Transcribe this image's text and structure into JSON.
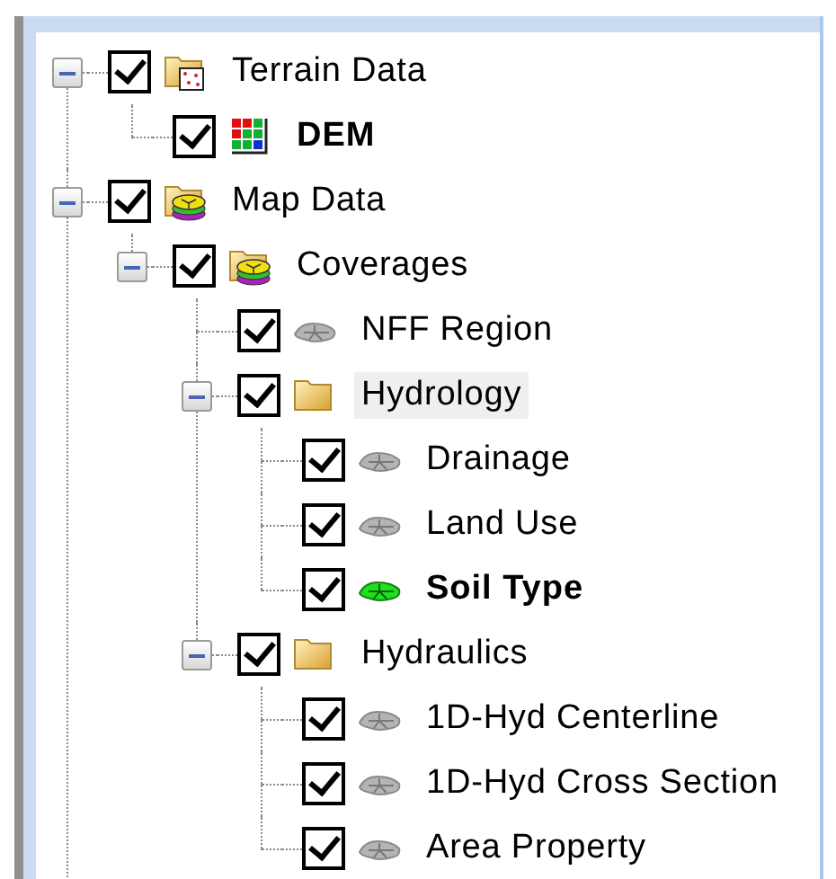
{
  "tree": [
    {
      "label": "Terrain Data",
      "kind": "image-folder",
      "checked": true,
      "active": false,
      "selected": false,
      "expanded": true,
      "children": [
        {
          "label": "DEM",
          "kind": "grid",
          "checked": true,
          "active": true,
          "selected": false
        }
      ]
    },
    {
      "label": "Map Data",
      "kind": "layers",
      "checked": true,
      "active": false,
      "selected": false,
      "expanded": true,
      "children": [
        {
          "label": "Coverages",
          "kind": "layers",
          "checked": true,
          "active": false,
          "selected": false,
          "expanded": true,
          "children": [
            {
              "label": "NFF Region",
              "kind": "coverage",
              "checked": true,
              "active": false,
              "selected": false
            },
            {
              "label": "Hydrology",
              "kind": "folder",
              "checked": true,
              "active": false,
              "selected": true,
              "expanded": true,
              "children": [
                {
                  "label": "Drainage",
                  "kind": "coverage",
                  "checked": true,
                  "active": false,
                  "selected": false
                },
                {
                  "label": "Land Use",
                  "kind": "coverage",
                  "checked": true,
                  "active": false,
                  "selected": false
                },
                {
                  "label": "Soil Type",
                  "kind": "coverage",
                  "checked": true,
                  "active": true,
                  "selected": false
                }
              ]
            },
            {
              "label": "Hydraulics",
              "kind": "folder",
              "checked": true,
              "active": false,
              "selected": false,
              "expanded": true,
              "children": [
                {
                  "label": "1D-Hyd Centerline",
                  "kind": "coverage",
                  "checked": true,
                  "active": false,
                  "selected": false
                },
                {
                  "label": "1D-Hyd Cross Section",
                  "kind": "coverage",
                  "checked": true,
                  "active": false,
                  "selected": false
                },
                {
                  "label": "Area Property",
                  "kind": "coverage",
                  "checked": true,
                  "active": false,
                  "selected": false
                }
              ]
            }
          ]
        }
      ]
    }
  ]
}
